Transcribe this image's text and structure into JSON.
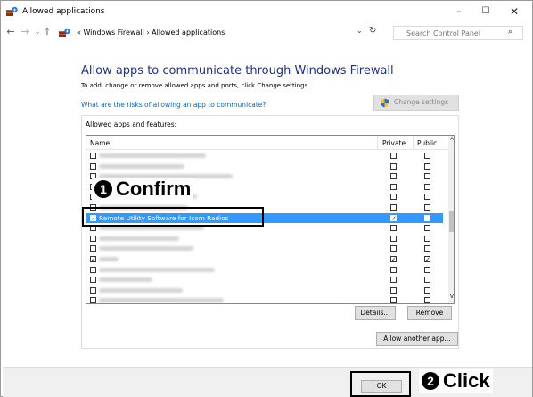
{
  "window": {
    "title": "Allowed applications"
  },
  "window_controls": {
    "minimize": "–",
    "maximize": "☐",
    "close": "✕"
  },
  "nav": {
    "back": "←",
    "forward": "→",
    "recent": "⌄",
    "up": "↑"
  },
  "address": {
    "breadcrumb": "« Windows Firewall › Allowed applications",
    "dropdown": "⌄",
    "refresh": "↻"
  },
  "search": {
    "placeholder": "Search Control Panel",
    "icon": "⌕"
  },
  "content": {
    "heading": "Allow apps to communicate through Windows Firewall",
    "subtext": "To add, change or remove allowed apps and ports, click Change settings.",
    "risk_link": "What are the risks of allowing an app to communicate?",
    "change_settings": "Change settings"
  },
  "apps": {
    "group_label": "Allowed apps and features:",
    "columns": {
      "name": "Name",
      "private": "Private",
      "public": "Public"
    },
    "rows": [
      {
        "name": "",
        "enabled": false,
        "private": false,
        "public": false,
        "selected": false
      },
      {
        "name": "",
        "enabled": false,
        "private": false,
        "public": false,
        "selected": false
      },
      {
        "name": "",
        "enabled": false,
        "private": false,
        "public": false,
        "selected": false
      },
      {
        "name": "",
        "enabled": false,
        "private": false,
        "public": false,
        "selected": false
      },
      {
        "name": "",
        "enabled": false,
        "private": false,
        "public": false,
        "selected": false
      },
      {
        "name": "",
        "enabled": false,
        "private": false,
        "public": false,
        "selected": false
      },
      {
        "name": "Remote Utility Software for Icom Radios",
        "enabled": true,
        "private": true,
        "public": false,
        "selected": true
      },
      {
        "name": "",
        "enabled": false,
        "private": false,
        "public": false,
        "selected": false
      },
      {
        "name": "",
        "enabled": false,
        "private": false,
        "public": false,
        "selected": false
      },
      {
        "name": "",
        "enabled": false,
        "private": false,
        "public": false,
        "selected": false
      },
      {
        "name": "",
        "enabled": true,
        "private": true,
        "public": true,
        "selected": false
      },
      {
        "name": "",
        "enabled": false,
        "private": false,
        "public": false,
        "selected": false
      },
      {
        "name": "",
        "enabled": false,
        "private": false,
        "public": false,
        "selected": false
      },
      {
        "name": "",
        "enabled": false,
        "private": false,
        "public": false,
        "selected": false
      },
      {
        "name": "",
        "enabled": false,
        "private": false,
        "public": false,
        "selected": false
      }
    ],
    "details_button": "Details...",
    "remove_button": "Remove",
    "allow_another_button": "Allow another app..."
  },
  "footer": {
    "ok_button": "OK"
  },
  "annotations": {
    "confirm": {
      "number": "1",
      "text": "Confirm"
    },
    "click": {
      "number": "2",
      "text": "Click"
    }
  },
  "colors": {
    "selection": "#3399ff",
    "heading": "#1e3287",
    "link": "#0066cc"
  }
}
